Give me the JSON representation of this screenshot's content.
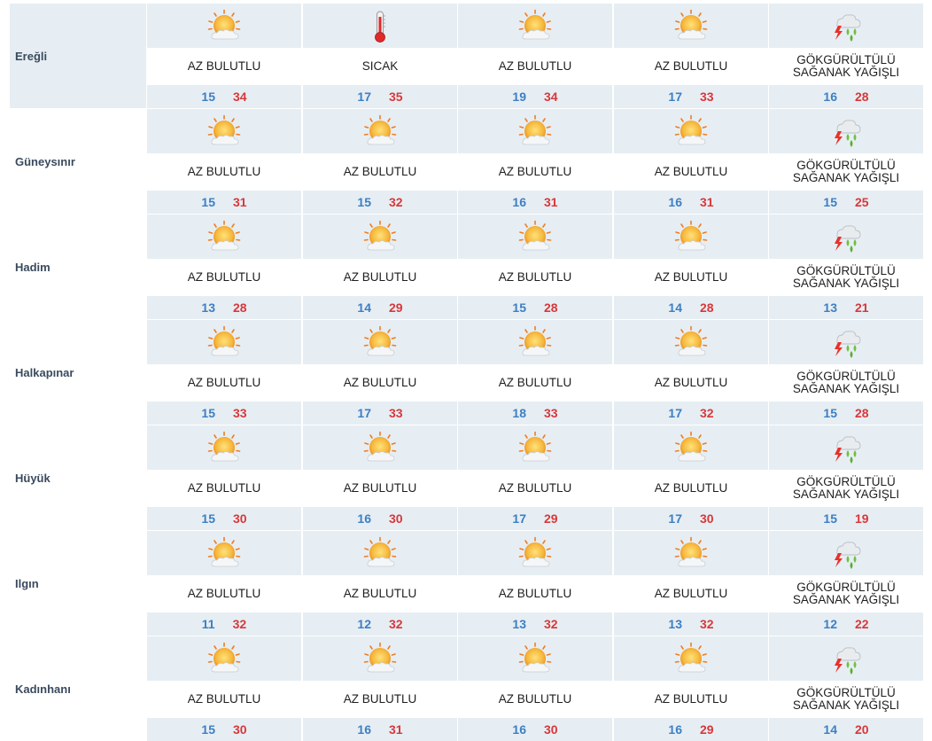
{
  "colors": {
    "band": "#e6eef3",
    "city_text": "#3a4a5e",
    "min_temp": "#3d7fc4",
    "max_temp": "#d8373a"
  },
  "cities": [
    {
      "name": "Ereğli",
      "days": [
        {
          "icon": "partly-cloudy-sun-icon",
          "condition": "AZ BULUTLU",
          "min": "15",
          "max": "34"
        },
        {
          "icon": "thermometer-hot-icon",
          "condition": "SICAK",
          "min": "17",
          "max": "35"
        },
        {
          "icon": "partly-cloudy-sun-icon",
          "condition": "AZ BULUTLU",
          "min": "19",
          "max": "34"
        },
        {
          "icon": "partly-cloudy-sun-icon",
          "condition": "AZ BULUTLU",
          "min": "17",
          "max": "33"
        },
        {
          "icon": "thunderstorm-rain-icon",
          "condition": "GÖKGÜRÜLTÜLÜ\nSAĞANAK YAĞIŞLI",
          "min": "16",
          "max": "28"
        }
      ]
    },
    {
      "name": "Güneysınır",
      "days": [
        {
          "icon": "partly-cloudy-sun-icon",
          "condition": "AZ BULUTLU",
          "min": "15",
          "max": "31"
        },
        {
          "icon": "partly-cloudy-sun-icon",
          "condition": "AZ BULUTLU",
          "min": "15",
          "max": "32"
        },
        {
          "icon": "partly-cloudy-sun-icon",
          "condition": "AZ BULUTLU",
          "min": "16",
          "max": "31"
        },
        {
          "icon": "partly-cloudy-sun-icon",
          "condition": "AZ BULUTLU",
          "min": "16",
          "max": "31"
        },
        {
          "icon": "thunderstorm-rain-icon",
          "condition": "GÖKGÜRÜLTÜLÜ\nSAĞANAK YAĞIŞLI",
          "min": "15",
          "max": "25"
        }
      ]
    },
    {
      "name": "Hadim",
      "days": [
        {
          "icon": "partly-cloudy-sun-icon",
          "condition": "AZ BULUTLU",
          "min": "13",
          "max": "28"
        },
        {
          "icon": "partly-cloudy-sun-icon",
          "condition": "AZ BULUTLU",
          "min": "14",
          "max": "29"
        },
        {
          "icon": "partly-cloudy-sun-icon",
          "condition": "AZ BULUTLU",
          "min": "15",
          "max": "28"
        },
        {
          "icon": "partly-cloudy-sun-icon",
          "condition": "AZ BULUTLU",
          "min": "14",
          "max": "28"
        },
        {
          "icon": "thunderstorm-rain-icon",
          "condition": "GÖKGÜRÜLTÜLÜ\nSAĞANAK YAĞIŞLI",
          "min": "13",
          "max": "21"
        }
      ]
    },
    {
      "name": "Halkapınar",
      "days": [
        {
          "icon": "partly-cloudy-sun-icon",
          "condition": "AZ BULUTLU",
          "min": "15",
          "max": "33"
        },
        {
          "icon": "partly-cloudy-sun-icon",
          "condition": "AZ BULUTLU",
          "min": "17",
          "max": "33"
        },
        {
          "icon": "partly-cloudy-sun-icon",
          "condition": "AZ BULUTLU",
          "min": "18",
          "max": "33"
        },
        {
          "icon": "partly-cloudy-sun-icon",
          "condition": "AZ BULUTLU",
          "min": "17",
          "max": "32"
        },
        {
          "icon": "thunderstorm-rain-icon",
          "condition": "GÖKGÜRÜLTÜLÜ\nSAĞANAK YAĞIŞLI",
          "min": "15",
          "max": "28"
        }
      ]
    },
    {
      "name": "Hüyük",
      "days": [
        {
          "icon": "partly-cloudy-sun-icon",
          "condition": "AZ BULUTLU",
          "min": "15",
          "max": "30"
        },
        {
          "icon": "partly-cloudy-sun-icon",
          "condition": "AZ BULUTLU",
          "min": "16",
          "max": "30"
        },
        {
          "icon": "partly-cloudy-sun-icon",
          "condition": "AZ BULUTLU",
          "min": "17",
          "max": "29"
        },
        {
          "icon": "partly-cloudy-sun-icon",
          "condition": "AZ BULUTLU",
          "min": "17",
          "max": "30"
        },
        {
          "icon": "thunderstorm-rain-icon",
          "condition": "GÖKGÜRÜLTÜLÜ\nSAĞANAK YAĞIŞLI",
          "min": "15",
          "max": "19"
        }
      ]
    },
    {
      "name": "Ilgın",
      "days": [
        {
          "icon": "partly-cloudy-sun-icon",
          "condition": "AZ BULUTLU",
          "min": "11",
          "max": "32"
        },
        {
          "icon": "partly-cloudy-sun-icon",
          "condition": "AZ BULUTLU",
          "min": "12",
          "max": "32"
        },
        {
          "icon": "partly-cloudy-sun-icon",
          "condition": "AZ BULUTLU",
          "min": "13",
          "max": "32"
        },
        {
          "icon": "partly-cloudy-sun-icon",
          "condition": "AZ BULUTLU",
          "min": "13",
          "max": "32"
        },
        {
          "icon": "thunderstorm-rain-icon",
          "condition": "GÖKGÜRÜLTÜLÜ\nSAĞANAK YAĞIŞLI",
          "min": "12",
          "max": "22"
        }
      ]
    },
    {
      "name": "Kadınhanı",
      "days": [
        {
          "icon": "partly-cloudy-sun-icon",
          "condition": "AZ BULUTLU",
          "min": "15",
          "max": "30"
        },
        {
          "icon": "partly-cloudy-sun-icon",
          "condition": "AZ BULUTLU",
          "min": "16",
          "max": "31"
        },
        {
          "icon": "partly-cloudy-sun-icon",
          "condition": "AZ BULUTLU",
          "min": "16",
          "max": "30"
        },
        {
          "icon": "partly-cloudy-sun-icon",
          "condition": "AZ BULUTLU",
          "min": "16",
          "max": "29"
        },
        {
          "icon": "thunderstorm-rain-icon",
          "condition": "GÖKGÜRÜLTÜLÜ\nSAĞANAK YAĞIŞLI",
          "min": "14",
          "max": "20"
        }
      ]
    }
  ]
}
